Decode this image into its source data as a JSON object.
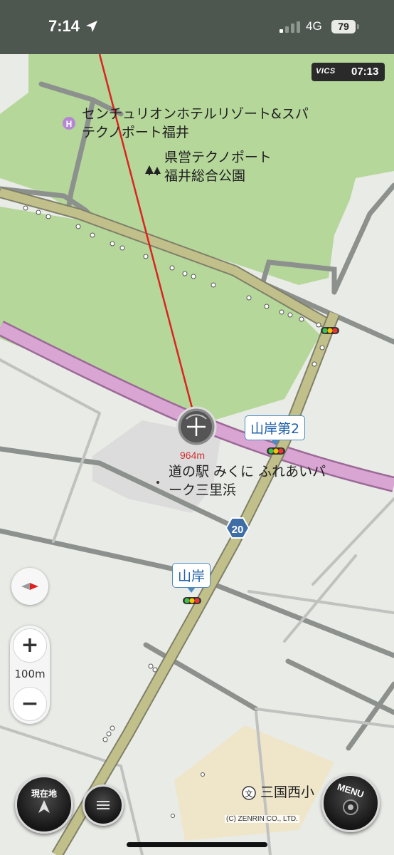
{
  "status_bar": {
    "time": "7:14",
    "network": "4G",
    "battery": "79",
    "location_icon": "location-arrow-icon",
    "signal_icon": "cellular-signal-icon"
  },
  "vics": {
    "logo": "VICS",
    "time": "07:13"
  },
  "map": {
    "labels": {
      "hotel_line1": "センチュリオンホテルリゾート&スパ",
      "hotel_line2": "テクノポート福井",
      "park_line1": "県営テクノポート",
      "park_line2": "福井総合公園",
      "michinoeki_line1": "道の駅 みくに ふれあいパ",
      "michinoeki_line2": "ーク三里浜",
      "school": "三国西小"
    },
    "intersections": {
      "yamagishi2": "山岸第2",
      "yamagishi": "山岸"
    },
    "route_number": "20",
    "distance": "964m",
    "icons": {
      "hotel": "H",
      "school": "文"
    }
  },
  "controls": {
    "zoom_in": "+",
    "zoom_out": "−",
    "scale": "100m",
    "current_location": "現在地",
    "menu": "MENU"
  },
  "copyright": "(C) ZENRIN CO., LTD.",
  "colors": {
    "park": "#b5d79a",
    "pink_road": "#d9a6d3",
    "main_road": "#c2c08a",
    "route_line": "#dd2222",
    "status_bar": "#4e5650"
  }
}
